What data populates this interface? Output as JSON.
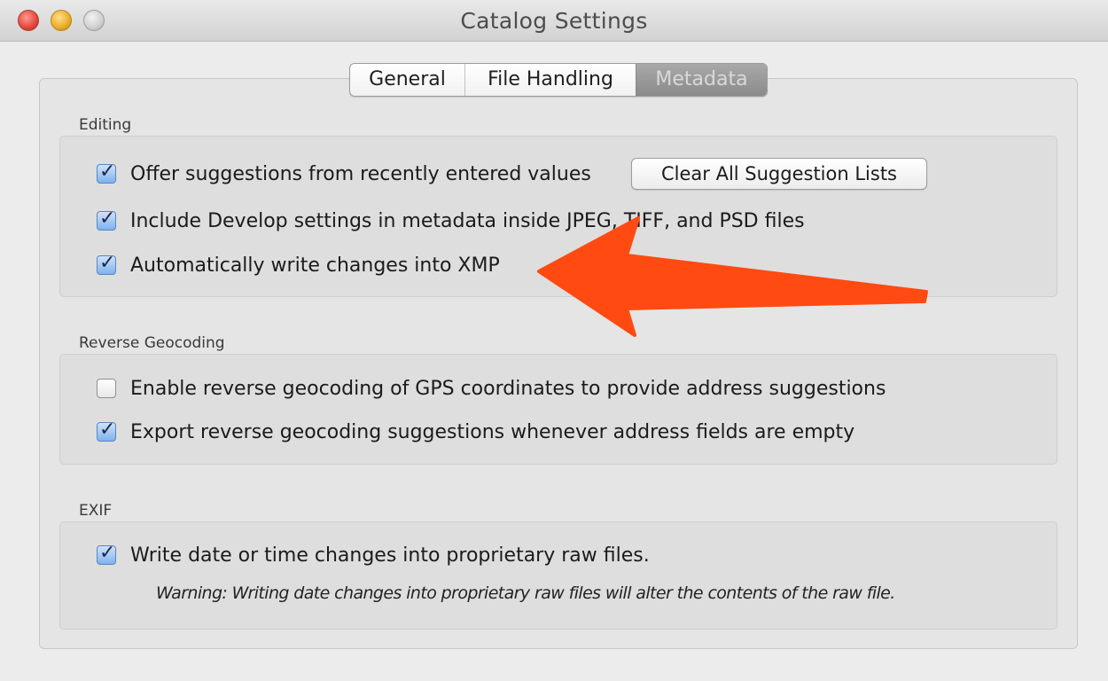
{
  "window": {
    "title": "Catalog Settings"
  },
  "tabs": [
    {
      "label": "General",
      "selected": false
    },
    {
      "label": "File Handling",
      "selected": false
    },
    {
      "label": "Metadata",
      "selected": true
    }
  ],
  "editing": {
    "header": "Editing",
    "offer_suggestions": {
      "label": "Offer suggestions from recently entered values",
      "checked": true
    },
    "clear_button": "Clear All Suggestion Lists",
    "include_develop": {
      "label": "Include Develop settings in metadata inside JPEG, TIFF, and PSD files",
      "checked": true
    },
    "auto_write_xmp": {
      "label": "Automatically write changes into XMP",
      "checked": true
    }
  },
  "reverse_geocoding": {
    "header": "Reverse Geocoding",
    "enable": {
      "label": "Enable reverse geocoding of GPS coordinates to provide address suggestions",
      "checked": false
    },
    "export": {
      "label": "Export reverse geocoding suggestions whenever address fields are empty",
      "checked": true
    }
  },
  "exif": {
    "header": "EXIF",
    "write_date": {
      "label": "Write date or time changes into proprietary raw files.",
      "checked": true
    },
    "warning": "Warning: Writing date changes into proprietary raw files will alter the contents of the raw file."
  },
  "annotation": {
    "arrow_color": "#ff4a12"
  },
  "icons": {
    "checkmark": "✓"
  }
}
